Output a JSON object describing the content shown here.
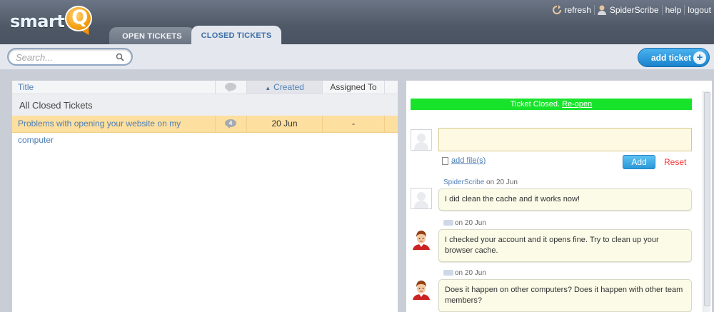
{
  "app": {
    "logo_text": "smart",
    "logo_letter": "Q"
  },
  "tabs": [
    {
      "label": "OPEN TICKETS",
      "active": false
    },
    {
      "label": "CLOSED TICKETS",
      "active": true
    }
  ],
  "toplinks": {
    "refresh": "refresh",
    "user": "SpiderScribe",
    "help": "help",
    "logout": "logout"
  },
  "search": {
    "placeholder": "Search..."
  },
  "add_ticket": {
    "label": "add ticket",
    "plus": "+"
  },
  "ticket_list": {
    "columns": {
      "title": "Title",
      "created": "Created",
      "assigned_to": "Assigned To"
    },
    "group_label": "All Closed Tickets",
    "rows": [
      {
        "title": "Problems with opening your website on my computer",
        "comments": "4",
        "created": "20 Jun",
        "assigned_to": "-"
      }
    ]
  },
  "ticket_detail": {
    "status_text": "Ticket Closed.",
    "reopen_label": "Re-open",
    "add_files_label": "add file(s)",
    "add_button": "Add",
    "reset_button": "Reset",
    "messages": [
      {
        "author": "SpiderScribe",
        "on": "on 20 Jun",
        "text": "I did clean the cache and it works now!"
      },
      {
        "author": "",
        "on": "on 20 Jun",
        "text": "I checked your account and it opens fine. Try to clean up your browser cache."
      },
      {
        "author": "",
        "on": "on 20 Jun",
        "text": "Does it happen on other computers? Does it happen with other team members?"
      }
    ]
  },
  "colors": {
    "status_closed": "#18e32b",
    "selected_row": "#fddf9f",
    "accent_blue": "#4f7fb6",
    "reset_red": "#ee3333"
  }
}
